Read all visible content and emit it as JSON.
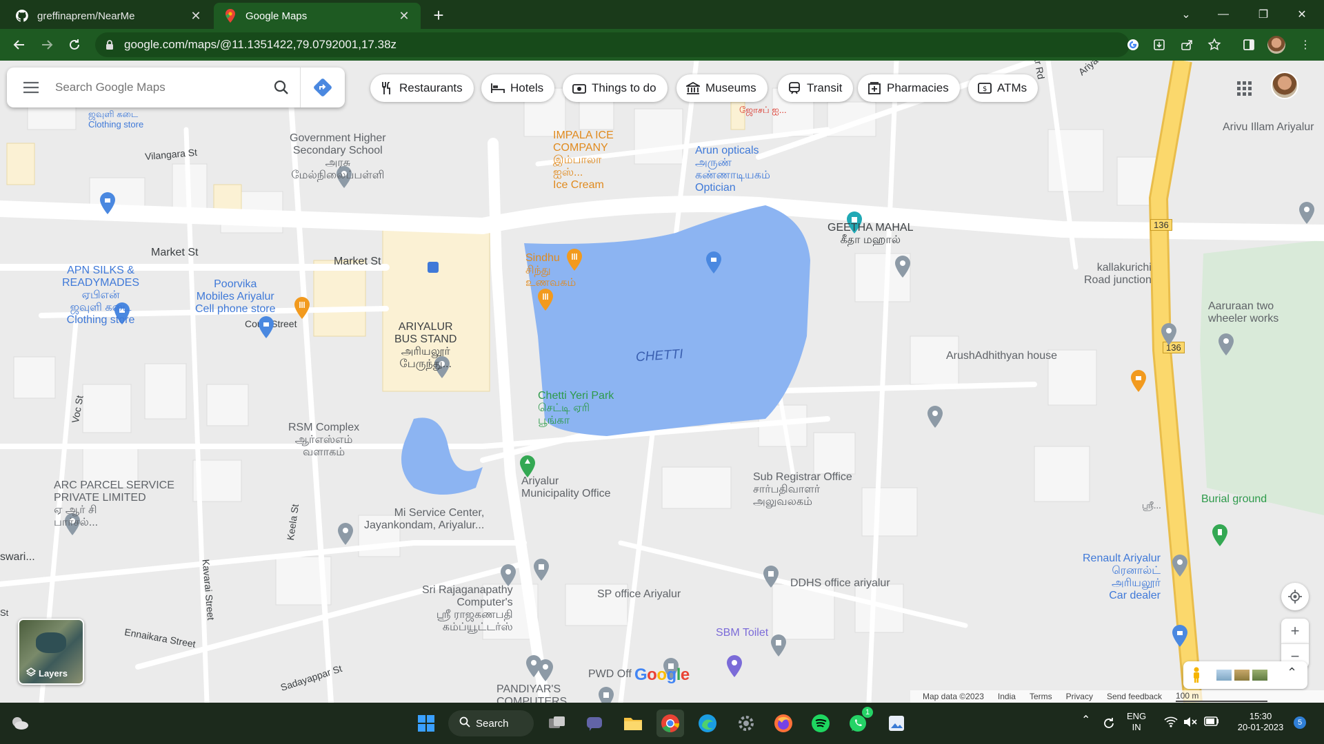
{
  "browser": {
    "tabs": [
      {
        "label": "greffinaprem/NearMe",
        "icon": "github-icon"
      },
      {
        "label": "Google Maps",
        "icon": "maps-icon"
      }
    ],
    "url": "google.com/maps/@11.1351422,79.0792001,17.38z"
  },
  "search": {
    "placeholder": "Search Google Maps"
  },
  "chips": [
    {
      "label": "Restaurants",
      "icon": "restaurant-icon"
    },
    {
      "label": "Hotels",
      "icon": "hotel-icon"
    },
    {
      "label": "Things to do",
      "icon": "camera-icon"
    },
    {
      "label": "Museums",
      "icon": "museum-icon"
    },
    {
      "label": "Transit",
      "icon": "transit-icon"
    },
    {
      "label": "Pharmacies",
      "icon": "pharmacy-icon"
    },
    {
      "label": "ATMs",
      "icon": "atm-icon"
    }
  ],
  "places": {
    "clothing_top": [
      "ஜவுளி கடை",
      "Clothing store"
    ],
    "govt_school": [
      "Government Higher",
      "Secondary School",
      "அரசு",
      "மேல்நிலைப்பள்ளி"
    ],
    "impala": [
      "IMPALA ICE",
      "COMPANY",
      "இம்பாலா",
      "ஐஸ்...",
      "Ice Cream"
    ],
    "arun_opticals": [
      "Arun opticals",
      "அருண்",
      "கண்ணாடியகம்",
      "Optician"
    ],
    "geetha_mahal": [
      "GEETHA MAHAL",
      "கீதா மஹால்"
    ],
    "arivu_illam": "Arivu Illam Ariyalur",
    "top_red": "ஜோசப் ஐ...",
    "apn_silks": [
      "APN SILKS &",
      "READYMADES",
      "ஏபிஎன்",
      "ஜவுளி கடை",
      "Clothing store"
    ],
    "poorvika": [
      "Poorvika",
      "Mobiles Ariyalur",
      "Cell phone store"
    ],
    "sindhu": [
      "Sindhu",
      "சிந்து",
      "உணவகம்"
    ],
    "bus_stand": [
      "ARIYALUR",
      "BUS STAND",
      "அரியலூர்",
      "பேருந்து..."
    ],
    "lake_label": "CHETTI",
    "chetti_park": [
      "Chetti Yeri Park",
      "செட்டி ஏரி",
      "பூங்கா"
    ],
    "kallakurichi": [
      "kallakurichi",
      "Road junction"
    ],
    "aaruraan": [
      "Aaruraan two",
      "wheeler works"
    ],
    "arush": "ArushAdhithyan house",
    "rsm": [
      "RSM Complex",
      "ஆர்எஸ்எம்",
      "வளாகம்"
    ],
    "arc_parcel": [
      "ARC PARCEL SERVICE",
      "PRIVATE LIMITED",
      "ஏ ஆர் சி",
      "பார்சல்..."
    ],
    "municipality": [
      "Ariyalur",
      "Municipality Office"
    ],
    "sub_registrar": [
      "Sub Registrar Office",
      "சார்பதிவாளர்",
      "அலுவலகம்"
    ],
    "mi_service": [
      "Mi Service Center,",
      "Jayankondam, Ariyalur..."
    ],
    "burial": "Burial ground",
    "sri_right": "ஸ்ரீ...",
    "renault": [
      "Renault Ariyalur",
      "ரெனால்ட்",
      "அரியலூர்",
      "Car dealer"
    ],
    "ddhs": "DDHS office ariyalur",
    "sp_office": "SP office Ariyalur",
    "sbm_toilet": "SBM Toilet",
    "sri_raja": [
      "Sri Rajaganapathy",
      "Computer's",
      "ஸ்ரீ ராஜகணபதி",
      "கம்ப்யூட்டர்ஸ்"
    ],
    "pwd": "PWD Off",
    "pandiyar": [
      "PANDIYAR'S",
      "COMPUTERS"
    ],
    "swari": "swari...",
    "st_left": "St"
  },
  "streets": {
    "vilangara": "Vilangara St",
    "market1": "Market St",
    "market2": "Market St",
    "court": "Court Street",
    "voc": "Voc St",
    "keela": "Keela St",
    "kavarai": "Kavarai Street",
    "ennaikara": "Ennaikara Street",
    "sadayappar": "Sadayappar St",
    "ariya_top": "Ariya",
    "ar_rd": "ar Rd"
  },
  "route_shields": [
    "136",
    "136"
  ],
  "layers": {
    "label": "Layers"
  },
  "logo": "Google",
  "attribution": [
    "Map data ©2023",
    "India",
    "Terms",
    "Privacy",
    "Send feedback",
    "100 m"
  ],
  "taskbar": {
    "search_label": "Search",
    "lang": [
      "ENG",
      "IN"
    ],
    "time": "15:30",
    "date": "20-01-2023",
    "notif_count": "5",
    "whatsapp_badge": "1"
  },
  "colors": {
    "chrome_tab": "#1a3a1a",
    "chrome_toolbar": "#1e5a22",
    "water": "#8cb4f2",
    "road_yellow": "#fbd86c",
    "poi_blue": "#3f79d8"
  }
}
